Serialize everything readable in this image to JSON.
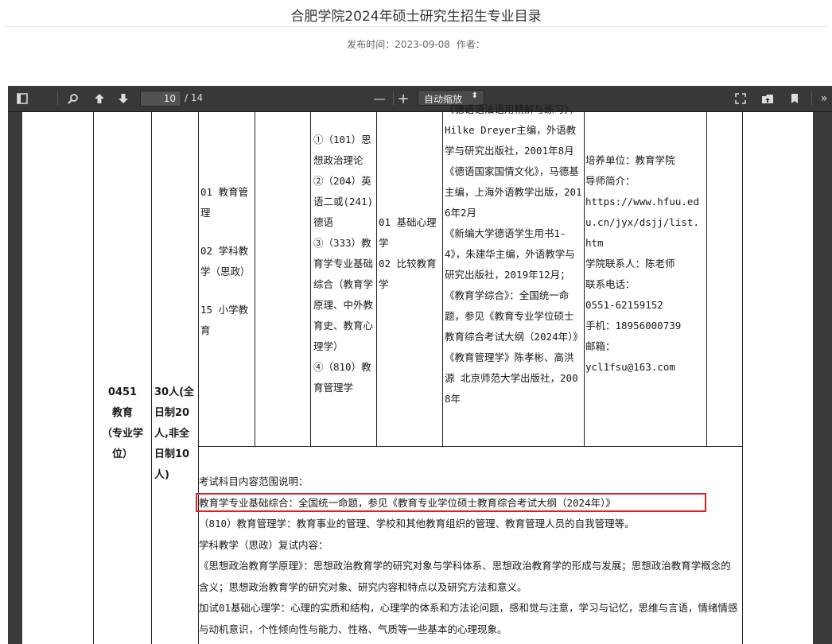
{
  "header": {
    "title": "合肥学院2024年硕士研究生招生专业目录",
    "publish_label": "发布时间：2023-09-08",
    "author_label": "作者："
  },
  "viewer": {
    "page_current": "10",
    "page_total": "/ 14",
    "zoom_label": "自动缩放",
    "zoom_out": "—",
    "zoom_in": "+"
  },
  "table": {
    "major_code": "0451",
    "major_name": "教育",
    "major_type": "（专业学位）",
    "enrollment": "30人(全日制20人,非全日制10人)",
    "directions": [
      "01 教育管理",
      "02 学科教学（思政）",
      "15 小学教育"
    ],
    "exam_subjects": [
      "①（101）思想政治理论",
      "②（204）英语二或(241)德语",
      "③（333）教育学专业基础综合（教育学原理、中外教育史、教育心理学）",
      "④（810）教育管理学"
    ],
    "retest_subjects": [
      "01 基础心理学",
      "02 比较教育学"
    ],
    "references": [
      "《德语语法语用精解与练习》，Hilke Dreyer主编，外语教学与研究出版社，2001年8月",
      "《德语国家国情文化》，马德基主编，上海外语教学出版，2016年2月",
      "《新编大学德语学生用书1-4》，朱建华主编，外语教学与研究出版社，2019年12月；",
      "《教育学综合》：全国统一命题，参见《教育专业学位硕士教育综合考试大纲（2024年）》",
      "《教育管理学》陈孝彬、高洪源 北京师范大学出版社，2008年"
    ],
    "contact": [
      "培养单位：教育学院",
      "导师简介：",
      "https://www.hfuu.edu.cn/jyx/dsjj/list.htm",
      "学院联系人：陈老师",
      "联系电话：",
      "0551-62159152",
      "手机：18956000739",
      "邮箱：",
      "ycl1fsu@163.com"
    ],
    "notes": [
      "考试科目内容范围说明：",
      "教育学专业基础综合：全国统一命题，参见《教育专业学位硕士教育综合考试大纲（2024年）》",
      "（810）教育管理学：教育事业的管理、学校和其他教育组织的管理、教育管理人员的自我管理等。",
      "学科教学（思政）复试内容：",
      "《思想政治教育学原理》：思想政治教育学的研究对象与学科体系、思想政治教育学的形成与发展；思想政治教育学概念的含义；思想政治教育学的研究对象、研究内容和特点以及研究方法和意义。",
      "加试01基础心理学：心理的实质和结构，心理学的体系和方法论问题，感和觉与注意，学习与记忆，思维与言语，情绪情感与动机意识，个性倾向性与能力、性格、气质等一些基本的心理现象。"
    ]
  }
}
